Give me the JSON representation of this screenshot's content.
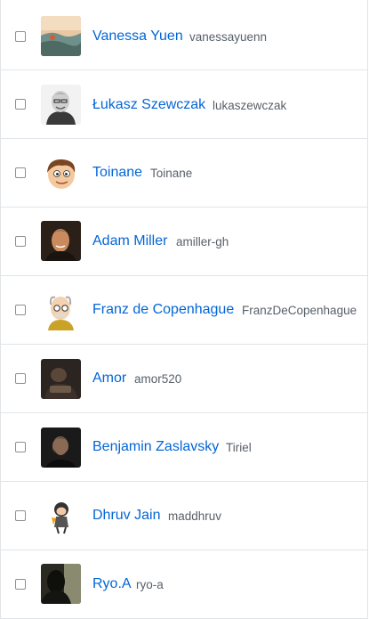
{
  "users": [
    {
      "name": "Vanessa Yuen",
      "login": "vanessayuenn",
      "avatar": "landscape-photo-avatar"
    },
    {
      "name": "Łukasz Szewczak",
      "login": "lukaszewczak",
      "avatar": "man-portrait-bw-avatar"
    },
    {
      "name": "Toinane",
      "login": "Toinane",
      "avatar": "cartoon-boy-avatar"
    },
    {
      "name": "Adam Miller",
      "login": "amiller-gh",
      "avatar": "man-photo-avatar"
    },
    {
      "name": "Franz de Copenhague",
      "login": "FranzDeCopenhague",
      "avatar": "cartoon-professor-avatar"
    },
    {
      "name": "Amor",
      "login": "amor520",
      "avatar": "dark-photo-avatar"
    },
    {
      "name": "Benjamin Zaslavsky",
      "login": "Tiriel",
      "avatar": "bearded-man-avatar"
    },
    {
      "name": "Dhruv Jain",
      "login": "maddhruv",
      "avatar": "octocat-avatar"
    },
    {
      "name": "Ryo.A",
      "login": "ryo-a",
      "avatar": "silhouette-photo-avatar"
    }
  ]
}
